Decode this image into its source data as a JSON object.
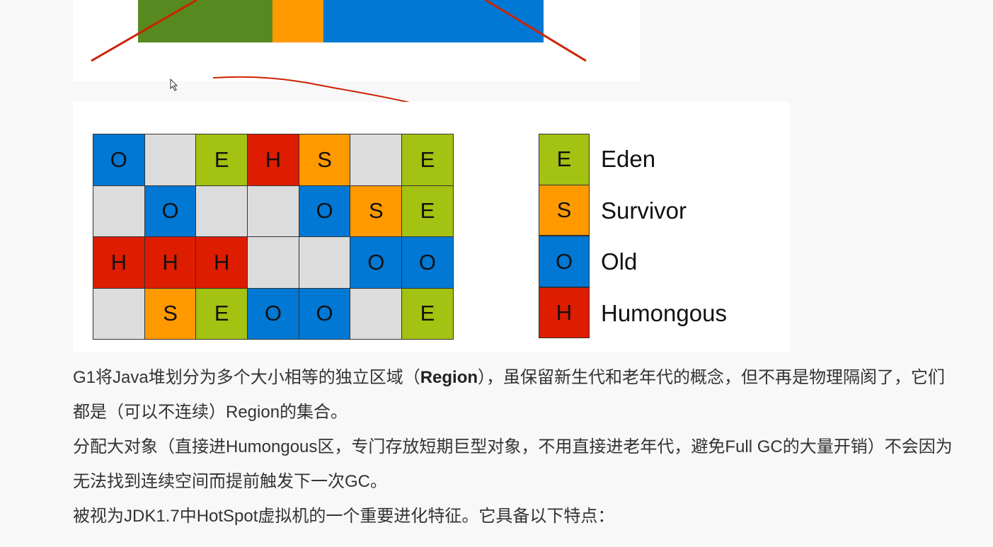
{
  "top_figure": {
    "bars": [
      {
        "color": "#56891f"
      },
      {
        "color": "#ff9900"
      },
      {
        "color": "#0078d4"
      }
    ]
  },
  "region_grid": {
    "cell_colors": {
      "E": "#a3c211",
      "S": "#ff9900",
      "O": "#0078d4",
      "H": "#dd1c00",
      "": "#dcdcdc"
    },
    "rows": [
      [
        "O",
        "",
        "E",
        "H",
        "S",
        "",
        "E"
      ],
      [
        "",
        "O",
        "",
        "",
        "O",
        "S",
        "E"
      ],
      [
        "H",
        "H",
        "H",
        "",
        "",
        "O",
        "O"
      ],
      [
        "",
        "S",
        "E",
        "O",
        "O",
        "",
        "E"
      ]
    ]
  },
  "legend": [
    {
      "letter": "E",
      "label": "Eden",
      "color": "#a3c211"
    },
    {
      "letter": "S",
      "label": "Survivor",
      "color": "#ff9900"
    },
    {
      "letter": "O",
      "label": "Old",
      "color": "#0078d4"
    },
    {
      "letter": "H",
      "label": "Humongous",
      "color": "#dd1c00"
    }
  ],
  "paragraphs": {
    "p1_before": "G1将Java堆划分为多个大小相等的独立区域（",
    "p1_bold": "Region",
    "p1_after": "），虽保留新生代和老年代的概念，但不再是物理隔阂了，它们都是（可以不连续）Region的集合。",
    "p2": "分配大对象（直接进Humongous区，专门存放短期巨型对象，不用直接进老年代，避免Full GC的大量开销）不会因为无法找到连续空间而提前触发下一次GC。",
    "p3": "被视为JDK1.7中HotSpot虚拟机的一个重要进化特征。它具备以下特点："
  },
  "annotation_color": "#cc2200"
}
